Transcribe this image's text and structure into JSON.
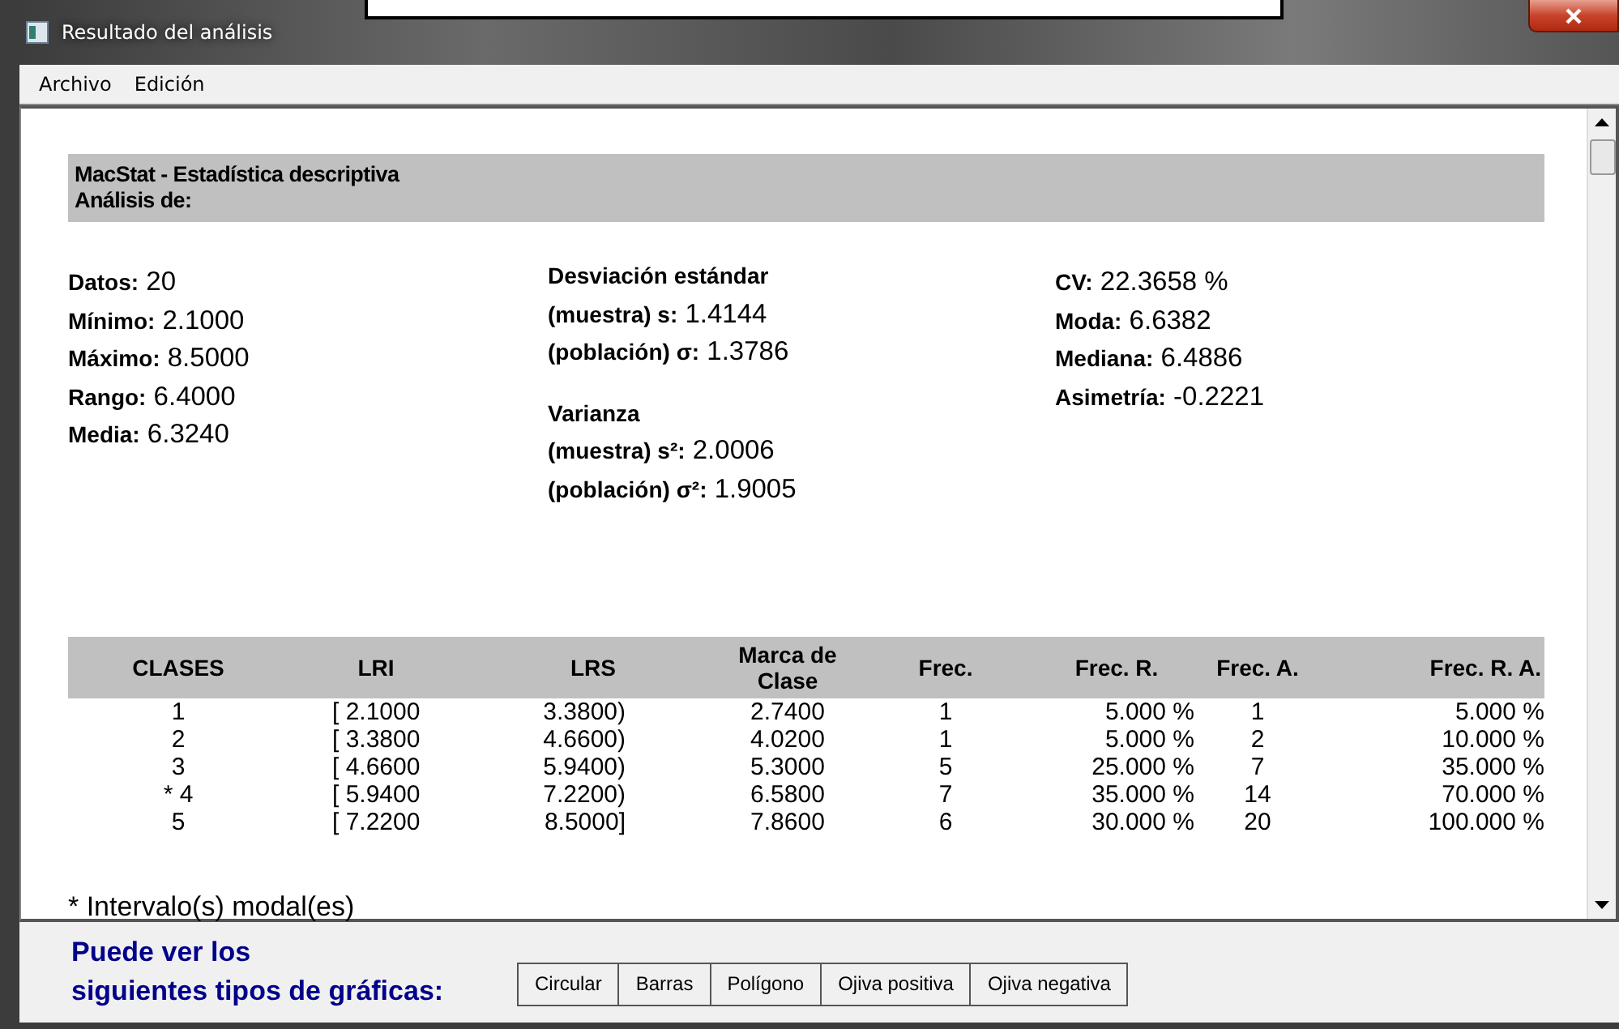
{
  "window": {
    "title": "Resultado del análisis"
  },
  "menu": [
    {
      "label": "Archivo"
    },
    {
      "label": "Edición"
    }
  ],
  "header": [
    "MacStat - Estadística descriptiva",
    "Análisis de:"
  ],
  "stats": [
    {
      "groups": [
        [
          {
            "kind": "value",
            "label": "Datos:",
            "value": "20"
          },
          {
            "kind": "value",
            "label": "Mínimo:",
            "value": "2.1000"
          },
          {
            "kind": "value",
            "label": "Máximo:",
            "value": "8.5000"
          },
          {
            "kind": "value",
            "label": "Rango:",
            "value": "6.4000"
          },
          {
            "kind": "value",
            "label": "Media:",
            "value": "6.3240"
          }
        ]
      ]
    },
    {
      "groups": [
        [
          {
            "kind": "heading",
            "text": "Desviación estándar"
          },
          {
            "kind": "value",
            "label": "(muestra) s:",
            "value": "1.4144"
          },
          {
            "kind": "value",
            "label": "(población) σ:",
            "value": "1.3786"
          }
        ],
        [
          {
            "kind": "heading",
            "text": "Varianza"
          },
          {
            "kind": "value",
            "label": "(muestra) s²:",
            "value": "2.0006"
          },
          {
            "kind": "value",
            "label": "(población) σ²:",
            "value": "1.9005"
          }
        ]
      ]
    },
    {
      "groups": [
        [
          {
            "kind": "value",
            "label": "CV:",
            "value": "22.3658 %"
          },
          {
            "kind": "value",
            "label": "Moda:",
            "value": "6.6382"
          },
          {
            "kind": "value",
            "label": "Mediana:",
            "value": "6.4886"
          },
          {
            "kind": "value",
            "label": "Asimetría:",
            "value": "-0.2221"
          }
        ]
      ]
    }
  ],
  "table": {
    "columns": [
      "CLASES",
      "LRI",
      "LRS",
      "Marca de Clase",
      "Frec.",
      "Frec. R.",
      "Frec. A.",
      "Frec. R. A."
    ],
    "rows": [
      [
        "1",
        "[ 2.1000",
        "3.3800)",
        "2.7400",
        "1",
        "5.000 %",
        "1",
        "5.000 %"
      ],
      [
        "2",
        "[ 3.3800",
        "4.6600)",
        "4.0200",
        "1",
        "5.000 %",
        "2",
        "10.000 %"
      ],
      [
        "3",
        "[ 4.6600",
        "5.9400)",
        "5.3000",
        "5",
        "25.000 %",
        "7",
        "35.000 %"
      ],
      [
        "* 4",
        "[ 5.9400",
        "7.2200)",
        "6.5800",
        "7",
        "35.000 %",
        "14",
        "70.000 %"
      ],
      [
        "5",
        "[ 7.2200",
        "8.5000]",
        "7.8600",
        "6",
        "30.000 %",
        "20",
        "100.000 %"
      ]
    ]
  },
  "footnote": "* Intervalo(s) modal(es)",
  "chart_prompt": [
    "Puede ver los",
    "siguientes tipos de gráficas:"
  ],
  "chart_buttons": [
    "Circular",
    "Barras",
    "Polígono",
    "Ojiva positiva",
    "Ojiva negativa"
  ]
}
